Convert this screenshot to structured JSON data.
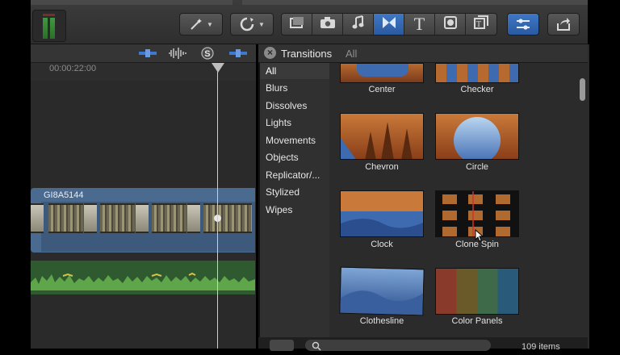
{
  "timeline": {
    "timecode": "00:00:22:00",
    "clip_name": "GI8A5144"
  },
  "browser": {
    "title": "Transitions",
    "breadcrumb": "All",
    "categories": [
      "All",
      "Blurs",
      "Dissolves",
      "Lights",
      "Movements",
      "Objects",
      "Replicator/...",
      "Stylized",
      "Wipes"
    ],
    "selected_category": "All",
    "transitions": [
      "Center",
      "Checker",
      "Chevron",
      "Circle",
      "Clock",
      "Clone Spin",
      "Clothesline",
      "Color Panels"
    ],
    "item_count": "109 items"
  },
  "toolbar": {
    "icons": [
      "audio-meter-icon",
      "magic-wand-icon",
      "retime-icon",
      "photo-browser-icon",
      "camera-icon",
      "music-icon",
      "transitions-icon",
      "titles-icon",
      "generators-icon",
      "themes-icon",
      "inspector-icon",
      "share-icon"
    ]
  },
  "colors": {
    "accent": "#3a6fbf",
    "clip": "#4a6a8f",
    "audio": "#2f5a2f"
  }
}
